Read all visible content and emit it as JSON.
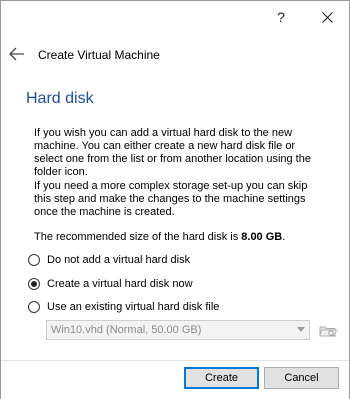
{
  "titlebar": {
    "help_label": "?",
    "close_label": "✕"
  },
  "header": {
    "title": "Create Virtual Machine"
  },
  "page": {
    "title": "Hard disk",
    "description_1": "If you wish you can add a virtual hard disk to the new machine. You can either create a new hard disk file or select one from the list or from another location using the folder icon.",
    "description_2": "If you need a more complex storage set-up you can skip this step and make the changes to the machine settings once the machine is created.",
    "recommend_prefix": "The recommended size of the hard disk is ",
    "recommend_size": "8.00 GB",
    "recommend_suffix": "."
  },
  "options": {
    "no_disk": "Do not add a virtual hard disk",
    "create_new": "Create a virtual hard disk now",
    "use_existing": "Use an existing virtual hard disk file",
    "selected": "create_new"
  },
  "existing_disk": {
    "value": "Win10.vhd (Normal, 50.00 GB)"
  },
  "footer": {
    "create_label": "Create",
    "cancel_label": "Cancel"
  }
}
